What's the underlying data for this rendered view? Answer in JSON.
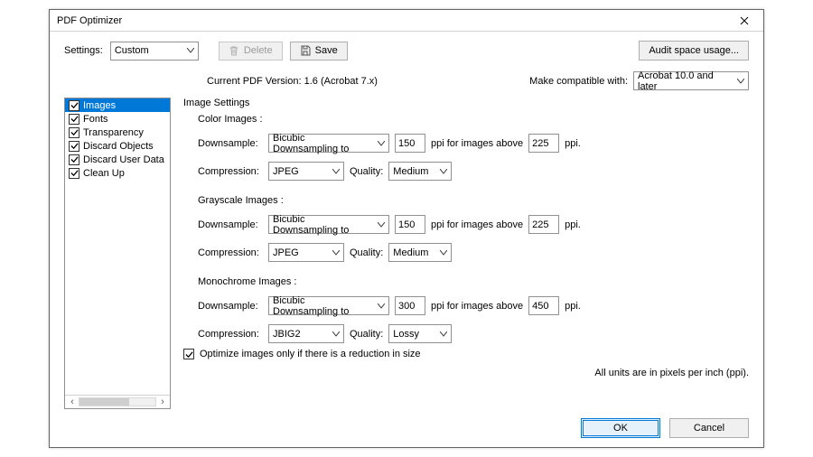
{
  "window": {
    "title": "PDF Optimizer",
    "close_aria": "Close"
  },
  "top": {
    "settings_label": "Settings:",
    "settings_value": "Custom",
    "delete_label": "Delete",
    "save_label": "Save",
    "audit_label": "Audit space usage..."
  },
  "version": {
    "current_label": "Current PDF Version: 1.6 (Acrobat 7.x)",
    "compat_label": "Make compatible with:",
    "compat_value": "Acrobat 10.0 and later"
  },
  "sidebar": {
    "items": [
      {
        "label": "Images",
        "checked": true,
        "selected": true
      },
      {
        "label": "Fonts",
        "checked": true,
        "selected": false
      },
      {
        "label": "Transparency",
        "checked": true,
        "selected": false
      },
      {
        "label": "Discard Objects",
        "checked": true,
        "selected": false
      },
      {
        "label": "Discard User Data",
        "checked": true,
        "selected": false
      },
      {
        "label": "Clean Up",
        "checked": true,
        "selected": false
      }
    ]
  },
  "panel": {
    "title": "Image Settings",
    "downsample_label": "Downsample:",
    "compression_label": "Compression:",
    "quality_label": "Quality:",
    "ppi_between": "ppi for images above",
    "ppi_suffix": "ppi.",
    "groups": {
      "color": {
        "title": "Color Images :",
        "downsample_method": "Bicubic Downsampling to",
        "ppi": "150",
        "ppi_above": "225",
        "compression": "JPEG",
        "quality": "Medium"
      },
      "gray": {
        "title": "Grayscale Images :",
        "downsample_method": "Bicubic Downsampling to",
        "ppi": "150",
        "ppi_above": "225",
        "compression": "JPEG",
        "quality": "Medium"
      },
      "mono": {
        "title": "Monochrome Images :",
        "downsample_method": "Bicubic Downsampling to",
        "ppi": "300",
        "ppi_above": "450",
        "compression": "JBIG2",
        "quality": "Lossy"
      }
    },
    "footnote": "All units are in pixels per inch (ppi).",
    "optimize_only_label": "Optimize images only if there is a reduction in size",
    "optimize_only_checked": true
  },
  "buttons": {
    "ok": "OK",
    "cancel": "Cancel"
  }
}
